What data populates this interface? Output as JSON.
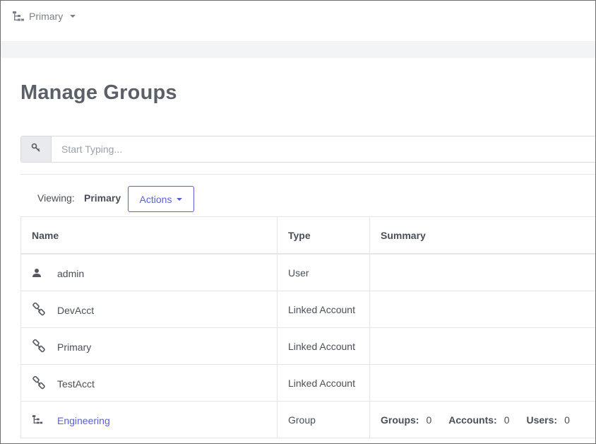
{
  "topbar": {
    "org_name": "Primary",
    "org_icon": "hierarchy-icon"
  },
  "page": {
    "title": "Manage Groups"
  },
  "search": {
    "placeholder": "Start Typing...",
    "icon": "key-icon"
  },
  "toolbar": {
    "viewing_label": "Viewing:",
    "viewing_value": "Primary",
    "actions_label": "Actions"
  },
  "table": {
    "headers": [
      "Name",
      "Type",
      "Summary"
    ],
    "rows": [
      {
        "icon": "user-icon",
        "name": "admin",
        "type": "User",
        "is_link": false
      },
      {
        "icon": "chain-link-icon",
        "name": "DevAcct",
        "type": "Linked Account",
        "is_link": false
      },
      {
        "icon": "chain-link-icon",
        "name": "Primary",
        "type": "Linked Account",
        "is_link": false
      },
      {
        "icon": "chain-link-icon",
        "name": "TestAcct",
        "type": "Linked Account",
        "is_link": false
      },
      {
        "icon": "hierarchy-icon",
        "name": "Engineering",
        "type": "Group",
        "is_link": true,
        "summary": {
          "groups_label": "Groups:",
          "groups_value": "0",
          "accounts_label": "Accounts:",
          "accounts_value": "0",
          "users_label": "Users:",
          "users_value": "0"
        }
      }
    ]
  },
  "colors": {
    "accent": "#5a5fd8",
    "text": "#4a4f57",
    "title": "#5b6068",
    "muted": "#7a7f88",
    "band": "#f3f4f6"
  }
}
